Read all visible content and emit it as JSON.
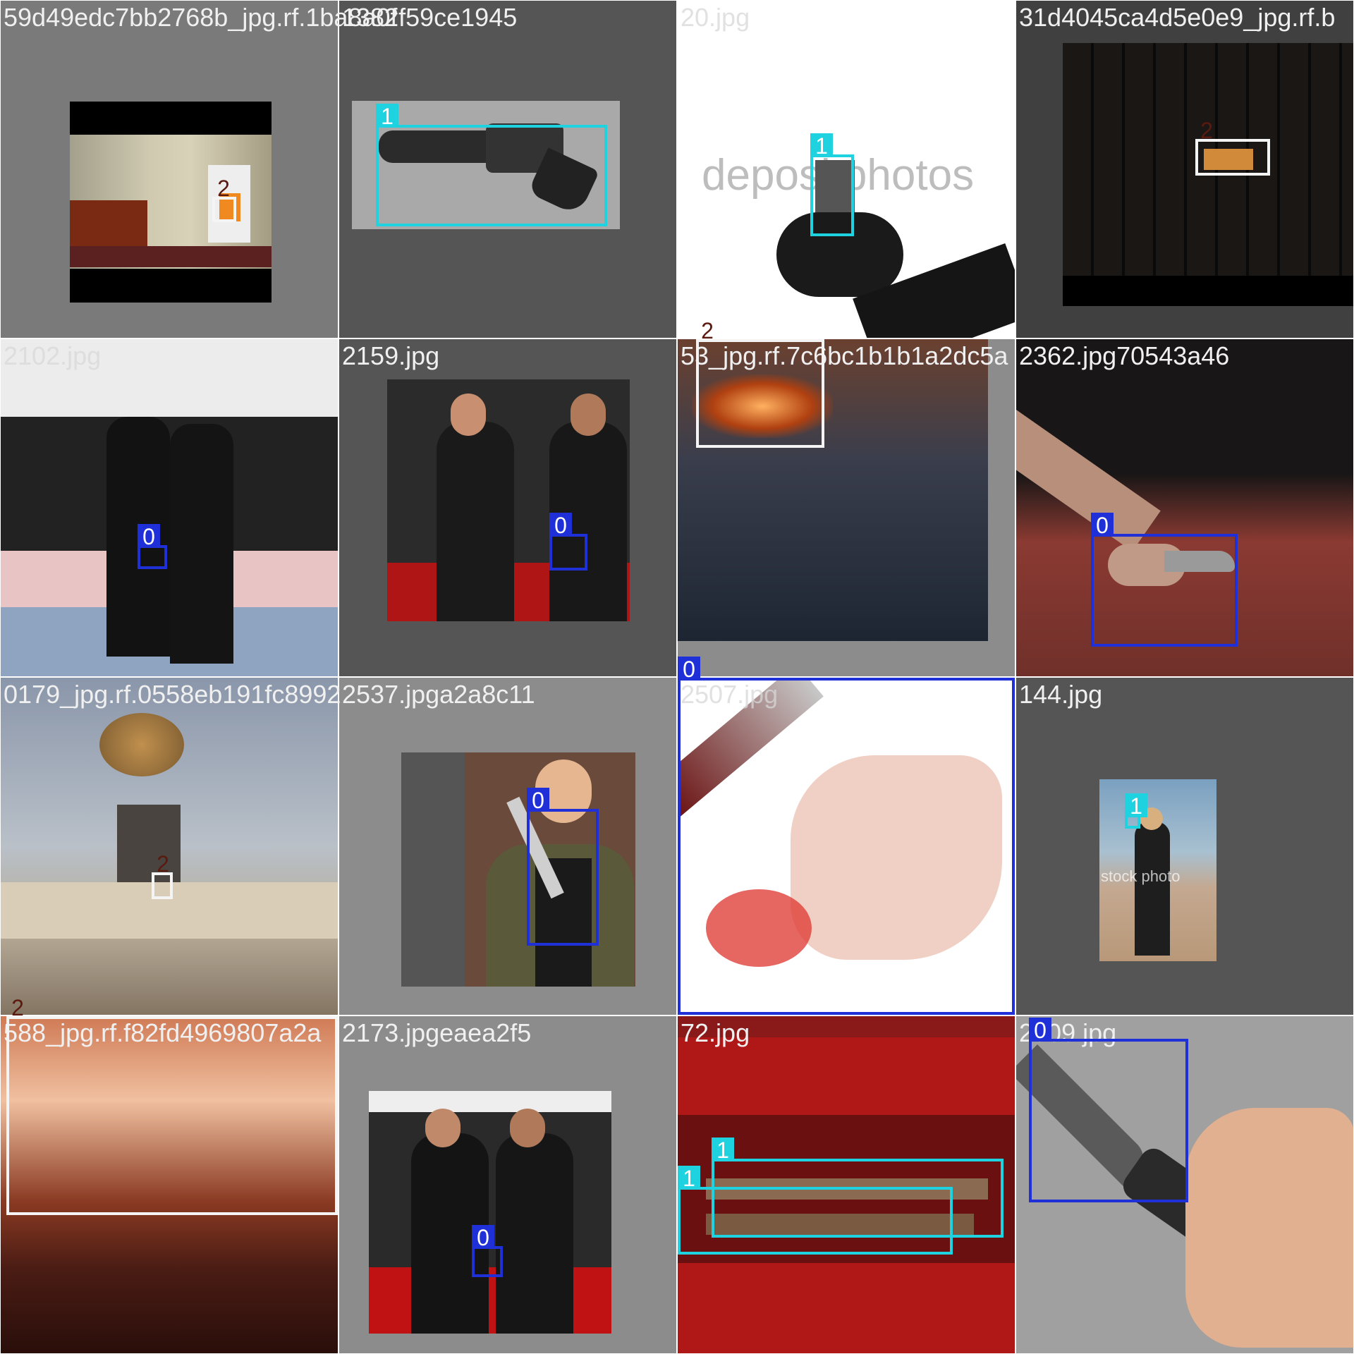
{
  "mosaic": {
    "tiles": [
      {
        "name": "59d49edc7bb2768b_jpg.rf.1ba8a0f",
        "scene": "room-with-fireplace",
        "boxes": [
          {
            "cls": "2"
          }
        ]
      },
      {
        "name": "1382f59ce1945",
        "scene": "revolver",
        "boxes": [
          {
            "cls": "1"
          }
        ]
      },
      {
        "name": "20.jpg",
        "scene": "gloved-hand-gun",
        "boxes": [
          {
            "cls": "1"
          }
        ],
        "watermark": "depositphotos"
      },
      {
        "name": "31d4045ca4d5e0e9_jpg.rf.b",
        "scene": "dark-fireplace",
        "boxes": [
          {
            "cls": "2"
          }
        ]
      },
      {
        "name": "2102.jpg",
        "scene": "martial-arts-dojo",
        "boxes": [
          {
            "cls": "0"
          }
        ]
      },
      {
        "name": "2159.jpg",
        "scene": "two-men-knife",
        "boxes": [
          {
            "cls": "0"
          }
        ]
      },
      {
        "name": "53_jpg.rf.7c6bc1b1b1a2dc5a",
        "scene": "burning-embers",
        "boxes": [
          {
            "cls": "2"
          }
        ]
      },
      {
        "name": "2362.jpg70543a46",
        "scene": "hand-knife",
        "boxes": [
          {
            "cls": "0"
          }
        ]
      },
      {
        "name": "0179_jpg.rf.0558eb191fc8992",
        "scene": "living-room",
        "boxes": [
          {
            "cls": "2"
          }
        ]
      },
      {
        "name": "2537.jpga2a8c11",
        "scene": "chef-knife",
        "boxes": [
          {
            "cls": "0"
          }
        ]
      },
      {
        "name": "2507.jpg",
        "scene": "bloody-hand-knife",
        "boxes": [
          {
            "cls": "0"
          }
        ]
      },
      {
        "name": "144.jpg",
        "scene": "man-with-gun",
        "boxes": [
          {
            "cls": "1"
          }
        ],
        "watermark": "stock photo"
      },
      {
        "name": "588_jpg.rf.f82fd4969807a2a",
        "scene": "flames",
        "boxes": [
          {
            "cls": "2"
          }
        ]
      },
      {
        "name": "2173.jpgeaea2f5",
        "scene": "two-men-knife-red",
        "boxes": [
          {
            "cls": "0"
          }
        ]
      },
      {
        "name": "72.jpg",
        "scene": "pistol-case",
        "boxes": [
          {
            "cls": "1"
          },
          {
            "cls": "1"
          }
        ]
      },
      {
        "name": "2909.jpg",
        "scene": "folding-knife",
        "boxes": [
          {
            "cls": "0"
          }
        ]
      }
    ]
  },
  "class_colors": {
    "0": "#1f30d9",
    "1": "#1fd2e0",
    "2": "#f4f4f4"
  }
}
